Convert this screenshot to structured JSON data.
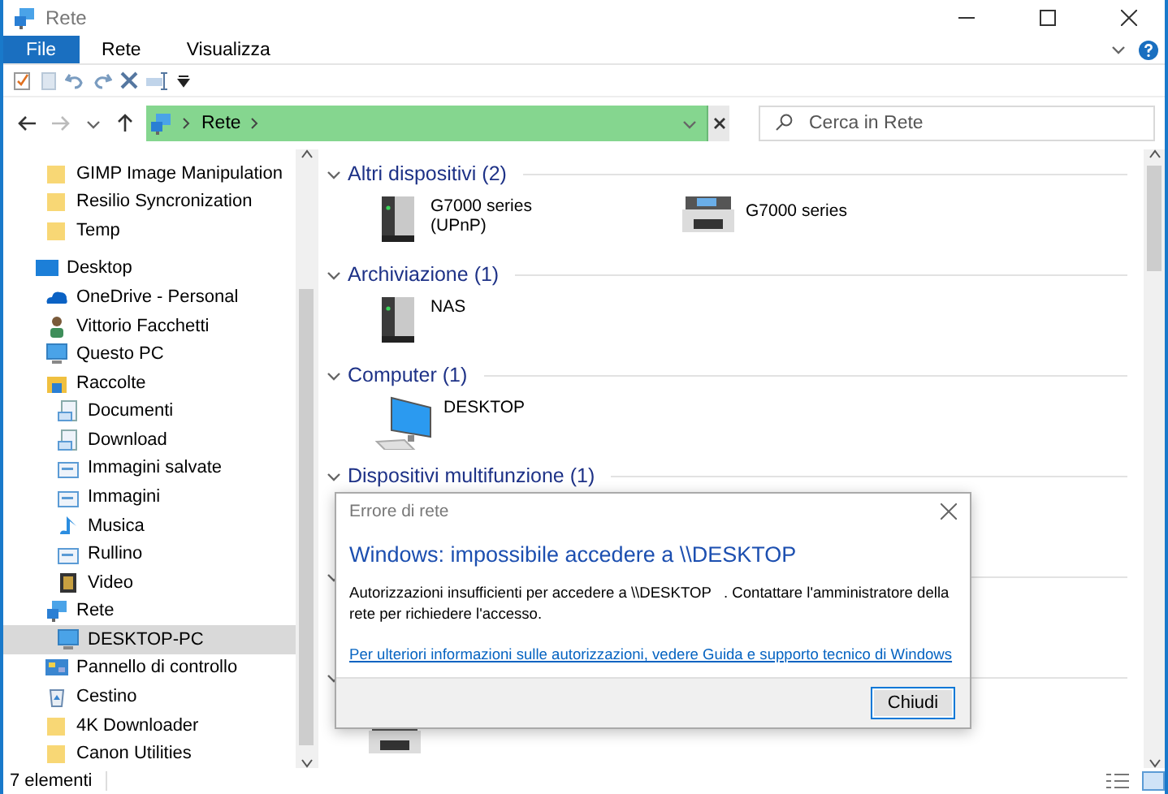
{
  "window": {
    "title": "Rete"
  },
  "ribbon_tabs": [
    {
      "label": "File",
      "selected": true
    },
    {
      "label": "Rete",
      "selected": false
    },
    {
      "label": "Visualizza",
      "selected": false
    }
  ],
  "address_bar": {
    "path": [
      {
        "label": "Rete"
      }
    ]
  },
  "search": {
    "placeholder": "Cerca in Rete"
  },
  "navigation": {
    "partial_items": [
      {
        "label": "GIMP Image Manipulation",
        "kind": "folder",
        "selected": false
      },
      {
        "label": "Resilio Syncronization",
        "kind": "folder",
        "selected": false
      },
      {
        "label": "Temp",
        "kind": "folder",
        "selected": false
      }
    ],
    "tree": [
      {
        "label": "Desktop",
        "kind": "desktop",
        "selected": false,
        "children": [
          {
            "label": "OneDrive - Personal",
            "kind": "cloud",
            "selected": false
          },
          {
            "label": "Vittorio Facchetti",
            "kind": "user",
            "selected": false
          },
          {
            "label": "Questo PC",
            "kind": "pc",
            "selected": false
          },
          {
            "label": "Raccolte",
            "kind": "library",
            "selected": false,
            "children": [
              {
                "label": "Documenti",
                "kind": "document",
                "selected": false
              },
              {
                "label": "Download",
                "kind": "document",
                "selected": false
              },
              {
                "label": "Immagini salvate",
                "kind": "image",
                "selected": false
              },
              {
                "label": "Immagini",
                "kind": "image",
                "selected": false
              },
              {
                "label": "Musica",
                "kind": "music",
                "selected": false
              },
              {
                "label": "Rullino",
                "kind": "image",
                "selected": false
              },
              {
                "label": "Video",
                "kind": "video",
                "selected": false
              }
            ]
          },
          {
            "label": "Rete",
            "kind": "network",
            "selected": false,
            "children": [
              {
                "label": "DESKTOP-PC",
                "kind": "pc",
                "selected": true
              }
            ]
          },
          {
            "label": "Pannello di controllo",
            "kind": "control",
            "selected": false
          },
          {
            "label": "Cestino",
            "kind": "recycle",
            "selected": false
          },
          {
            "label": "4K Downloader",
            "kind": "folder",
            "selected": false
          },
          {
            "label": "Canon Utilities",
            "kind": "folder",
            "selected": false
          }
        ]
      }
    ]
  },
  "groups": [
    {
      "title": "Altri dispositivi (2)",
      "items": [
        {
          "name": "G7000 series\n(UPnP)",
          "kind": "server"
        },
        {
          "name": "G7000 series",
          "kind": "printer"
        }
      ]
    },
    {
      "title": "Archiviazione (1)",
      "items": [
        {
          "name": "NAS",
          "kind": "server"
        }
      ]
    },
    {
      "title": "Computer (1)",
      "items": [
        {
          "name": "DESKTOP",
          "kind": "computer"
        }
      ]
    },
    {
      "title": "Dispositivi multifunzione (1)"
    }
  ],
  "dialog": {
    "title": "Errore di rete",
    "heading": "Windows: impossibile accedere a \\\\DESKTOP",
    "message": "Autorizzazioni insufficienti per accedere a \\\\DESKTOP   . Contattare l'amministratore della rete per richiedere l'accesso.",
    "link": "Per ulteriori informazioni sulle autorizzazioni, vedere Guida e supporto tecnico di Windows",
    "button": "Chiudi"
  },
  "status_bar": {
    "count": "7 elementi"
  }
}
